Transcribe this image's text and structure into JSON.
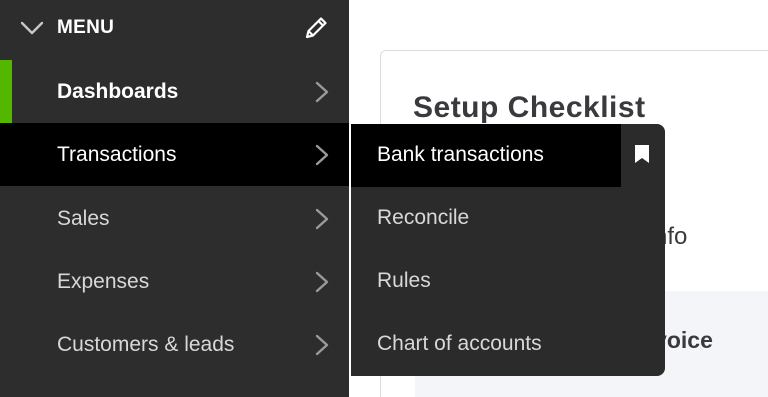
{
  "sidebar": {
    "menu_label": "MENU",
    "items": [
      {
        "label": "Dashboards"
      },
      {
        "label": "Transactions"
      },
      {
        "label": "Sales"
      },
      {
        "label": "Expenses"
      },
      {
        "label": "Customers & leads"
      }
    ]
  },
  "submenu": {
    "items": [
      {
        "label": "Bank transactions"
      },
      {
        "label": "Reconcile"
      },
      {
        "label": "Rules"
      },
      {
        "label": "Chart of accounts"
      }
    ]
  },
  "main": {
    "title": "Setup Checklist",
    "business_info_fragment": "s info",
    "invoice_fragment": "nvoice"
  },
  "colors": {
    "sidebar_bg": "#2d2d2d",
    "active_accent": "#53b700",
    "hover_bg": "#000000"
  }
}
